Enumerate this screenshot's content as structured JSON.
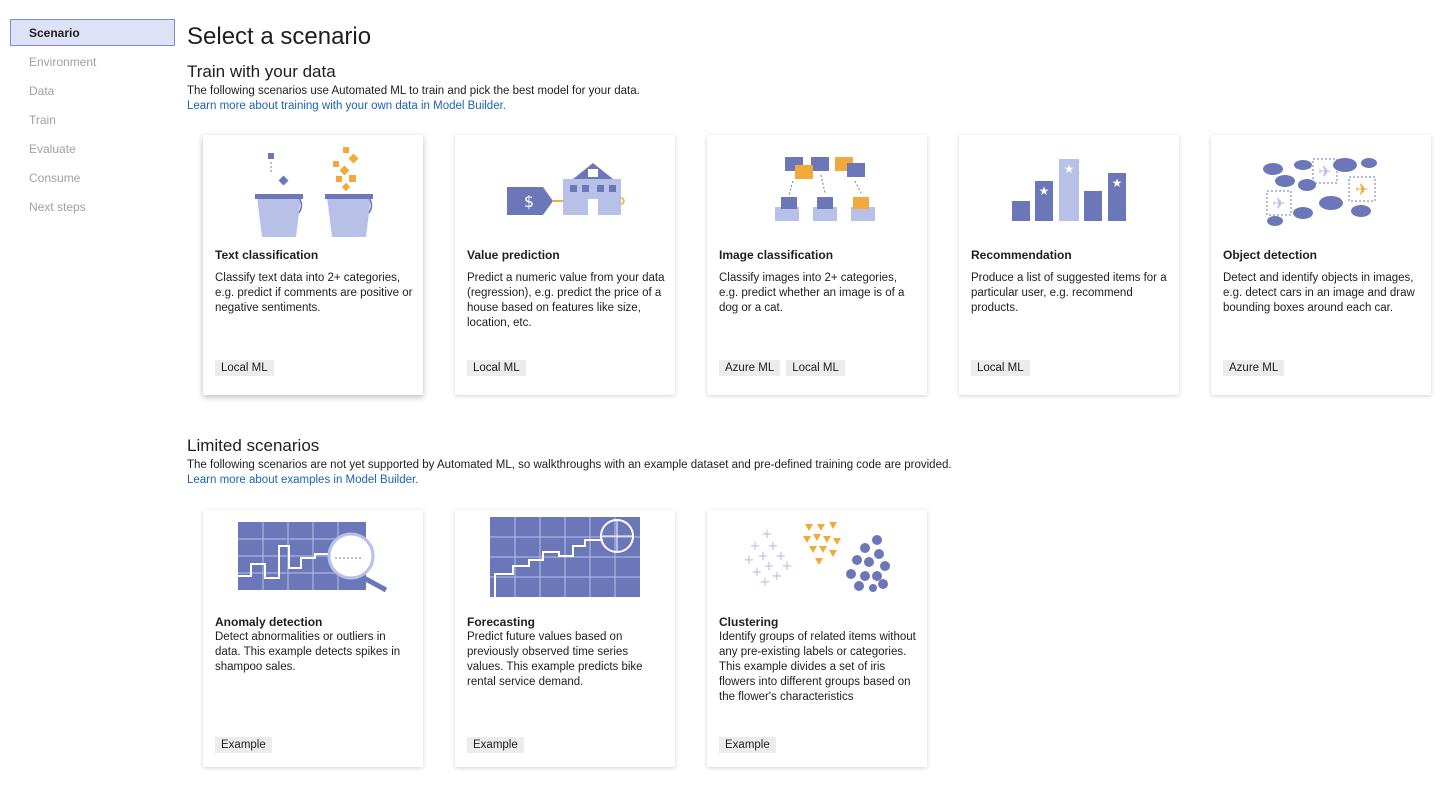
{
  "sidebar": {
    "items": [
      {
        "label": "Scenario",
        "active": true
      },
      {
        "label": "Environment",
        "active": false
      },
      {
        "label": "Data",
        "active": false
      },
      {
        "label": "Train",
        "active": false
      },
      {
        "label": "Evaluate",
        "active": false
      },
      {
        "label": "Consume",
        "active": false
      },
      {
        "label": "Next steps",
        "active": false
      }
    ]
  },
  "page": {
    "title": "Select a scenario"
  },
  "train": {
    "title": "Train with your data",
    "description": "The following scenarios use Automated ML to train and pick the best model for your data.",
    "link": "Learn more about training with your own data in Model Builder.",
    "cards": [
      {
        "icon": "buckets-icon",
        "title": "Text classification",
        "description": "Classify text data into 2+ categories, e.g. predict if comments are positive or negative sentiments.",
        "tags": [
          "Local ML"
        ]
      },
      {
        "icon": "house-price-icon",
        "title": "Value prediction",
        "description": "Predict a numeric value from your data (regression), e.g. predict the price of a house based on features like size, location, etc.",
        "tags": [
          "Local ML"
        ]
      },
      {
        "icon": "image-sorting-icon",
        "title": "Image classification",
        "description": "Classify images into 2+ categories, e.g. predict whether an image is of a dog or a cat.",
        "tags": [
          "Azure ML",
          "Local ML"
        ]
      },
      {
        "icon": "star-bars-icon",
        "title": "Recommendation",
        "description": "Produce a list of suggested items for a particular user, e.g. recommend products.",
        "tags": [
          "Local ML"
        ]
      },
      {
        "icon": "clouds-planes-icon",
        "title": "Object detection",
        "description": "Detect and identify objects in images, e.g. detect cars in an image and draw bounding boxes around each car.",
        "tags": [
          "Azure ML"
        ]
      }
    ]
  },
  "limited": {
    "title": "Limited scenarios",
    "description": "The following scenarios are not yet supported by Automated ML, so walkthroughs with an example dataset and pre-defined training code are provided.",
    "link": "Learn more about examples in Model Builder.",
    "cards": [
      {
        "icon": "magnifier-chart-icon",
        "title": "Anomaly detection",
        "description": "Detect abnormalities or outliers in data. This example detects spikes in shampoo sales.",
        "tags": [
          "Example"
        ]
      },
      {
        "icon": "forecast-chart-icon",
        "title": "Forecasting",
        "description": "Predict future values based on previously observed time series values. This example predicts bike rental service demand.",
        "tags": [
          "Example"
        ]
      },
      {
        "icon": "clusters-icon",
        "title": "Clustering",
        "description": "Identify groups of related items without any pre-existing labels or categories. This example divides a set of iris flowers into different groups based on the flower's characteristics",
        "tags": [
          "Example"
        ]
      }
    ]
  },
  "colors": {
    "accent_blue": "#6b77b8",
    "light_blue": "#b7c0e6",
    "orange": "#f2a93b",
    "link": "#1a63b8",
    "nav_active_bg": "#dde2f6"
  }
}
